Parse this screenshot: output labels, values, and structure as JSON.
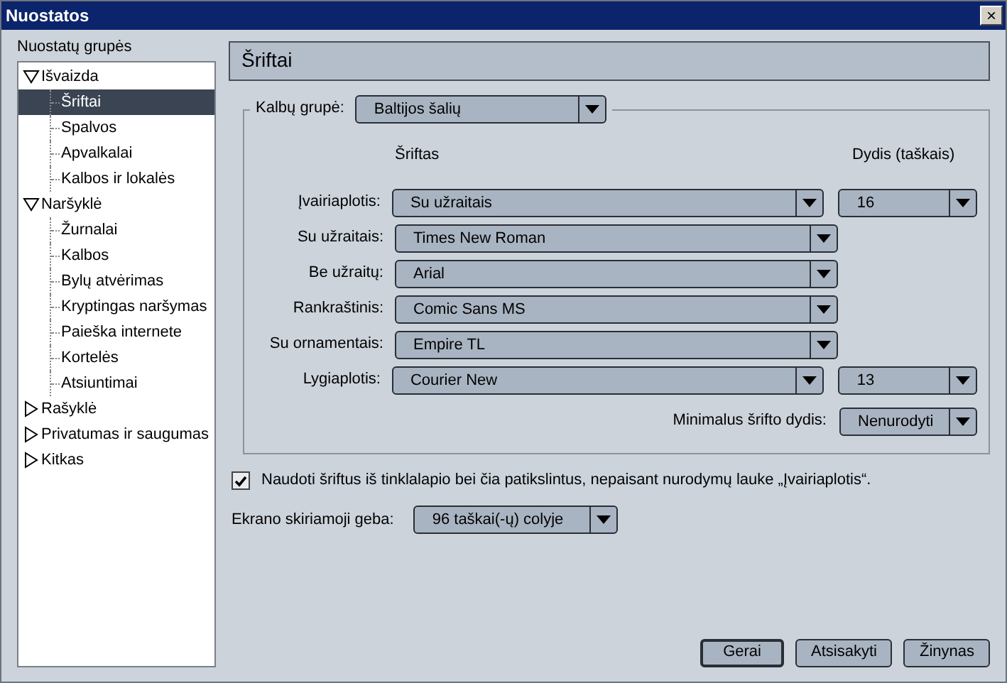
{
  "window": {
    "title": "Nuostatos",
    "close": "×"
  },
  "sidebar": {
    "title": "Nuostatų grupės",
    "items": [
      {
        "label": "Išvaizda",
        "expanded": true,
        "selected": false,
        "children": [
          {
            "label": "Šriftai",
            "selected": true
          },
          {
            "label": "Spalvos",
            "selected": false
          },
          {
            "label": "Apvalkalai",
            "selected": false
          },
          {
            "label": "Kalbos ir lokalės",
            "selected": false
          }
        ]
      },
      {
        "label": "Naršyklė",
        "expanded": true,
        "selected": false,
        "children": [
          {
            "label": "Žurnalai",
            "selected": false
          },
          {
            "label": "Kalbos",
            "selected": false
          },
          {
            "label": "Bylų atvėrimas",
            "selected": false
          },
          {
            "label": "Kryptingas naršymas",
            "selected": false
          },
          {
            "label": "Paieška internete",
            "selected": false
          },
          {
            "label": "Kortelės",
            "selected": false
          },
          {
            "label": "Atsiuntimai",
            "selected": false
          }
        ]
      },
      {
        "label": "Rašyklė",
        "expanded": false,
        "selected": false
      },
      {
        "label": "Privatumas ir saugumas",
        "expanded": false,
        "selected": false
      },
      {
        "label": "Kitkas",
        "expanded": false,
        "selected": false
      }
    ]
  },
  "panel": {
    "title": "Šriftai",
    "language_group": {
      "label": "Kalbų grupė:",
      "value": "Baltijos šalių"
    },
    "columns": {
      "font": "Šriftas",
      "size": "Dydis (taškais)"
    },
    "fonts": [
      {
        "label": "Įvairiaplotis:",
        "value": "Su užraitais",
        "size": "16"
      },
      {
        "label": "Su užraitais:",
        "value": "Times New Roman"
      },
      {
        "label": "Be užraitų:",
        "value": "Arial"
      },
      {
        "label": "Rankraštinis:",
        "value": "Comic Sans MS"
      },
      {
        "label": "Su ornamentais:",
        "value": "Empire TL"
      },
      {
        "label": "Lygiaplotis:",
        "value": "Courier New",
        "size": "13"
      }
    ],
    "min_size": {
      "label": "Minimalus šrifto dydis:",
      "value": "Nenurodyti"
    },
    "use_page_fonts": {
      "label": "Naudoti šriftus iš tinklalapio bei čia patikslintus, nepaisant nurodymų lauke „Įvairiaplotis“.",
      "checked": true
    },
    "resolution": {
      "label": "Ekrano skiriamoji geba:",
      "value": "96 taškai(-ų) colyje"
    }
  },
  "buttons": [
    {
      "label": "Gerai",
      "default": true
    },
    {
      "label": "Atsisakyti",
      "default": false
    },
    {
      "label": "Žinynas",
      "default": false
    }
  ]
}
